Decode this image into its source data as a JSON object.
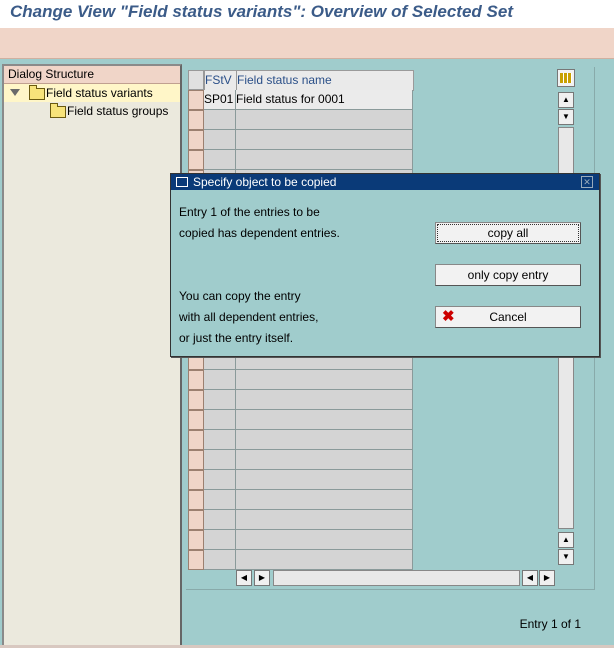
{
  "window": {
    "title": "Change View \"Field status variants\": Overview of Selected Set"
  },
  "tree": {
    "header": "Dialog Structure",
    "items": [
      {
        "label": "Field status variants",
        "selected": true,
        "expanded": true
      },
      {
        "label": "Field status groups",
        "selected": false
      }
    ]
  },
  "table": {
    "columns": [
      "FStV",
      "Field status name"
    ],
    "rows": [
      [
        "SP01",
        "Field status for 0001"
      ]
    ]
  },
  "dialog": {
    "title": "Specify object to be copied",
    "message_lines": [
      "Entry  1  of the entries to be",
      "copied has dependent entries."
    ],
    "info_lines": [
      "You can copy the entry",
      "with all dependent entries,",
      "or just the entry itself."
    ],
    "buttons": {
      "copy_all": "copy all",
      "only_copy": "only copy entry",
      "cancel": "Cancel"
    }
  },
  "status": {
    "entry_text": "Entry 1 of 1"
  },
  "colors": {
    "background": "#a0cccc",
    "title": "#3b5b88",
    "dialog_title_bar": "#0a3a78",
    "header_bar": "#f0d5c8"
  }
}
